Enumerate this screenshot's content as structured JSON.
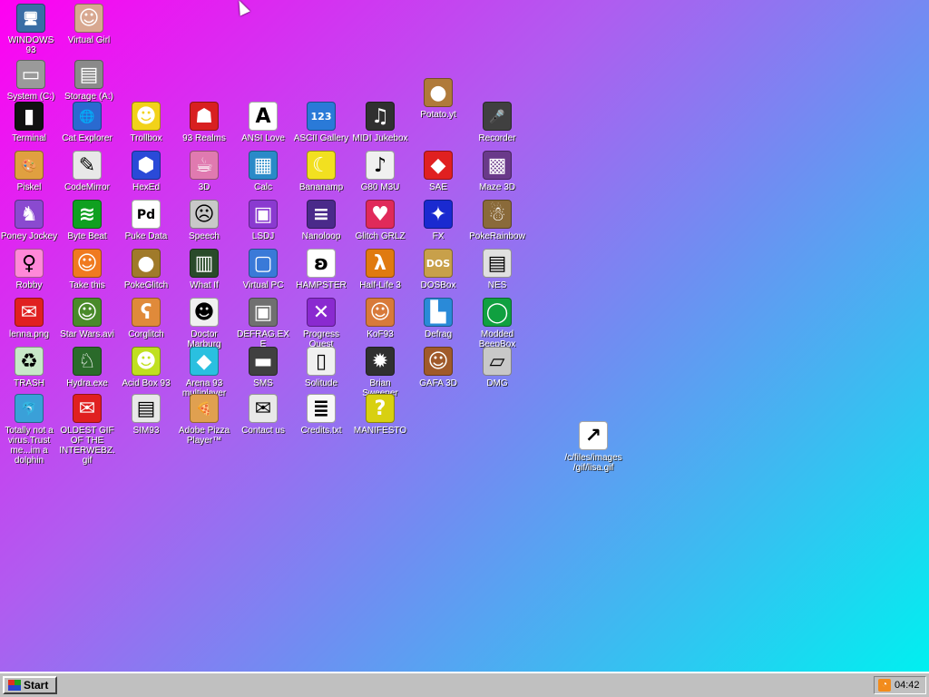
{
  "desktop": {
    "icons": [
      {
        "label": "WINDOWS 93",
        "glyph": "🖥",
        "color": "#3a6ea5"
      },
      {
        "label": "Virtual Girl",
        "glyph": "☺",
        "color": "#d8a890"
      },
      {
        "label": "System (C:)",
        "glyph": "▭",
        "color": "#9a9a9a"
      },
      {
        "label": "Storage (A:)",
        "glyph": "▤",
        "color": "#8a8a8a"
      },
      {
        "label": "Terminal",
        "glyph": "▮",
        "color": "#111111"
      },
      {
        "label": "Cat Explorer",
        "glyph": "🌐",
        "color": "#2a6ad0"
      },
      {
        "label": "Trollbox",
        "glyph": "☻",
        "color": "#f2d21a"
      },
      {
        "label": "93 Realms",
        "glyph": "☗",
        "color": "#d82020"
      },
      {
        "label": "ANSI Love",
        "glyph": "A",
        "color": "#ffffff"
      },
      {
        "label": "ASCII Gallery",
        "glyph": "123",
        "color": "#2a7ad8"
      },
      {
        "label": "MIDI Jukebox",
        "glyph": "♫",
        "color": "#303030"
      },
      {
        "label": "Potato.yt",
        "glyph": "●",
        "color": "#b07a3a"
      },
      {
        "label": "Recorder",
        "glyph": "🎤",
        "color": "#404040"
      },
      {
        "label": "Piskel",
        "glyph": "🎨",
        "color": "#e0a040"
      },
      {
        "label": "CodeMirror",
        "glyph": "✎",
        "color": "#e8e8e8"
      },
      {
        "label": "HexEd",
        "glyph": "⬢",
        "color": "#2a4ad8"
      },
      {
        "label": "3D",
        "glyph": "☕",
        "color": "#e07ab0"
      },
      {
        "label": "Calc",
        "glyph": "▦",
        "color": "#2a8ac8"
      },
      {
        "label": "Bananamp",
        "glyph": "☾",
        "color": "#f2e020"
      },
      {
        "label": "G80 M3U",
        "glyph": "♪",
        "color": "#f0f0f0"
      },
      {
        "label": "SAE",
        "glyph": "◆",
        "color": "#e02020"
      },
      {
        "label": "Maze 3D",
        "glyph": "▩",
        "color": "#6a3a8a"
      },
      {
        "label": "Poney Jockey",
        "glyph": "♞",
        "color": "#8a4ad0"
      },
      {
        "label": "Byte Beat",
        "glyph": "≋",
        "color": "#10a020"
      },
      {
        "label": "Puke Data",
        "glyph": "Pd",
        "color": "#ffffff"
      },
      {
        "label": "Speech",
        "glyph": "☹",
        "color": "#c8c8c8"
      },
      {
        "label": "LSDJ",
        "glyph": "▣",
        "color": "#8a3ad0"
      },
      {
        "label": "Nanoloop",
        "glyph": "≡",
        "color": "#4a2a8a"
      },
      {
        "label": "Glitch GRLZ",
        "glyph": "♥",
        "color": "#e02a5a"
      },
      {
        "label": "FX",
        "glyph": "✦",
        "color": "#1a2ad0"
      },
      {
        "label": "PokeRainbow",
        "glyph": "☃",
        "color": "#8a6a3a"
      },
      {
        "label": "Robby",
        "glyph": "♀",
        "color": "#ff88d8"
      },
      {
        "label": "Take this",
        "glyph": "☺",
        "color": "#f07a20"
      },
      {
        "label": "PokeGlitch",
        "glyph": "●",
        "color": "#a07a2a"
      },
      {
        "label": "What If",
        "glyph": "▥",
        "color": "#2a4a2a"
      },
      {
        "label": "Virtual PC",
        "glyph": "▢",
        "color": "#3a7ad8"
      },
      {
        "label": "HAMPSTER",
        "glyph": "ʚ",
        "color": "#ffffff"
      },
      {
        "label": "Half-Life 3",
        "glyph": "λ",
        "color": "#e07a10"
      },
      {
        "label": "DOSBox",
        "glyph": "DOS",
        "color": "#c8a04a"
      },
      {
        "label": "NES",
        "glyph": "▤",
        "color": "#e0e0e0"
      },
      {
        "label": "lenna.png",
        "glyph": "✉",
        "color": "#e02020"
      },
      {
        "label": "Star Wars.avi",
        "glyph": "☺",
        "color": "#4a8a2a"
      },
      {
        "label": "Corglitch",
        "glyph": "ʕ",
        "color": "#e08a3a"
      },
      {
        "label": "Doctor Marburg",
        "glyph": "☻",
        "color": "#f0f0f0"
      },
      {
        "label": "DEFRAG.EXE",
        "glyph": "▣",
        "color": "#707070"
      },
      {
        "label": "Progress Quest",
        "glyph": "✕",
        "color": "#8a2ad0"
      },
      {
        "label": "KoF93",
        "glyph": "☺",
        "color": "#d87a3a"
      },
      {
        "label": "Defrag",
        "glyph": "▙",
        "color": "#2a8ad8"
      },
      {
        "label": "Modded BeepBox",
        "glyph": "◯",
        "color": "#10a040"
      },
      {
        "label": "TRASH",
        "glyph": "♻",
        "color": "#c8e8c8"
      },
      {
        "label": "Hydra.exe",
        "glyph": "♘",
        "color": "#2a6a2a"
      },
      {
        "label": "Acid Box 93",
        "glyph": "☻",
        "color": "#c0e020"
      },
      {
        "label": "Arena 93 multiplayer",
        "glyph": "◆",
        "color": "#2ac0e0"
      },
      {
        "label": "SMS",
        "glyph": "▬",
        "color": "#404040"
      },
      {
        "label": "Solitude",
        "glyph": "▯",
        "color": "#f0f0f0"
      },
      {
        "label": "Brian Sweeper",
        "glyph": "✹",
        "color": "#303030"
      },
      {
        "label": "GAFA 3D",
        "glyph": "☺",
        "color": "#a05a2a"
      },
      {
        "label": "DMG",
        "glyph": "▱",
        "color": "#c8c8c8"
      },
      {
        "label": "Totally not a virus.Trust me...im a dolphin",
        "glyph": "🐬",
        "color": "#3aa0d8"
      },
      {
        "label": "OLDEST GIF OF THE INTERWEBZ.gif",
        "glyph": "✉",
        "color": "#e02020"
      },
      {
        "label": "SIM93",
        "glyph": "▤",
        "color": "#e8e8e8"
      },
      {
        "label": "Adobe Pizza Player™",
        "glyph": "🍕",
        "color": "#e0a050"
      },
      {
        "label": "Contact us",
        "glyph": "✉",
        "color": "#e8e8e8"
      },
      {
        "label": "Credits.txt",
        "glyph": "≣",
        "color": "#f8f8f8"
      },
      {
        "label": "MANIFESTO",
        "glyph": "?",
        "color": "#d8d010"
      },
      {
        "label": "/c/files/images/gif/lisa.gif",
        "glyph": "↗",
        "color": "#ffffff"
      }
    ]
  },
  "taskbar": {
    "start_label": "Start",
    "clock": "04:42",
    "rss_glyph": "◔"
  }
}
